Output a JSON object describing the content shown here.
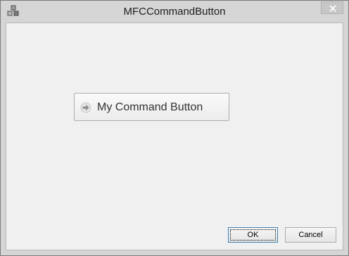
{
  "window": {
    "title": "MFCCommandButton",
    "icon": "app-icon",
    "close_icon": "close-icon"
  },
  "main": {
    "command_button": {
      "label": "My Command Button",
      "icon": "arrow-right-icon"
    }
  },
  "footer": {
    "ok_label": "OK",
    "cancel_label": "Cancel"
  },
  "colors": {
    "titlebar": "#d5d5d5",
    "client_bg": "#f0f0f0",
    "focus_border": "#3c7fb1"
  }
}
